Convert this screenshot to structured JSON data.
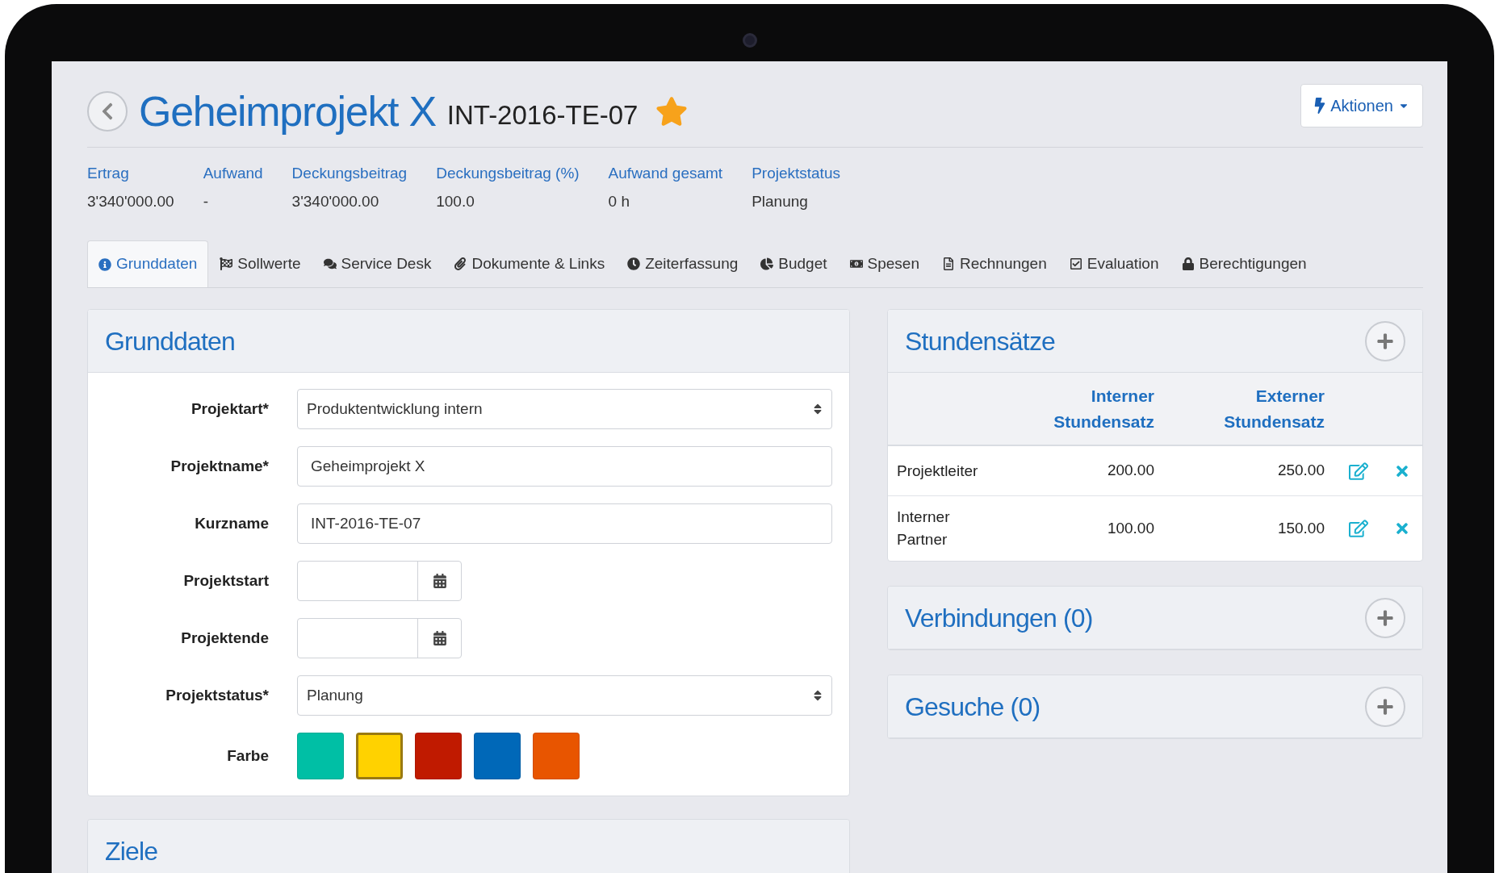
{
  "header": {
    "title": "Geheimprojekt X",
    "code": "INT-2016-TE-07",
    "favorite": true,
    "actions": "Aktionen"
  },
  "stats": [
    {
      "label": "Ertrag",
      "value": "3'340'000.00"
    },
    {
      "label": "Aufwand",
      "value": "-"
    },
    {
      "label": "Deckungsbeitrag",
      "value": "3'340'000.00"
    },
    {
      "label": "Deckungsbeitrag (%)",
      "value": "100.0"
    },
    {
      "label": "Aufwand gesamt",
      "value": "0 h"
    },
    {
      "label": "Projektstatus",
      "value": "Planung"
    }
  ],
  "tabs": [
    {
      "label": "Grunddaten",
      "selected": true
    },
    {
      "label": "Sollwerte",
      "selected": false
    },
    {
      "label": "Service Desk",
      "selected": false
    },
    {
      "label": "Dokumente & Links",
      "selected": false
    },
    {
      "label": "Zeiterfassung",
      "selected": false
    },
    {
      "label": "Budget",
      "selected": false
    },
    {
      "label": "Spesen",
      "selected": false
    },
    {
      "label": "Rechnungen",
      "selected": false
    },
    {
      "label": "Evaluation",
      "selected": false
    },
    {
      "label": "Berechtigungen",
      "selected": false
    }
  ],
  "grunddaten": {
    "title": "Grunddaten",
    "fields": [
      {
        "kind": "select",
        "label": "Projektart*",
        "value": "Produktentwicklung intern"
      },
      {
        "kind": "text",
        "label": "Projektname*",
        "value": "Geheimprojekt X"
      },
      {
        "kind": "text",
        "label": "Kurzname",
        "value": "INT-2016-TE-07"
      },
      {
        "kind": "date",
        "label": "Projektstart"
      },
      {
        "kind": "date",
        "label": "Projektende"
      },
      {
        "kind": "select",
        "label": "Projektstatus*",
        "value": "Planung"
      }
    ],
    "color_label": "Farbe",
    "colors": [
      {
        "color": "#00bfa5",
        "selected": false
      },
      {
        "color": "#ffd200",
        "selected": true
      },
      {
        "color": "#c01a00",
        "selected": false
      },
      {
        "color": "#0068b8",
        "selected": false
      },
      {
        "color": "#e85500",
        "selected": false
      }
    ]
  },
  "ziele": {
    "title": "Ziele"
  },
  "stundensaetze": {
    "title": "Stundensätze",
    "columns": [
      "Interner Stundensatz",
      "Externer Stundensatz"
    ],
    "rows": [
      {
        "role": "Projektleiter",
        "internal": "200.00",
        "external": "250.00"
      },
      {
        "role": "Interner Partner",
        "internal": "100.00",
        "external": "150.00"
      }
    ]
  },
  "panels": [
    {
      "title": "Verbindungen (0)"
    },
    {
      "title": "Gesuche (0)"
    }
  ]
}
